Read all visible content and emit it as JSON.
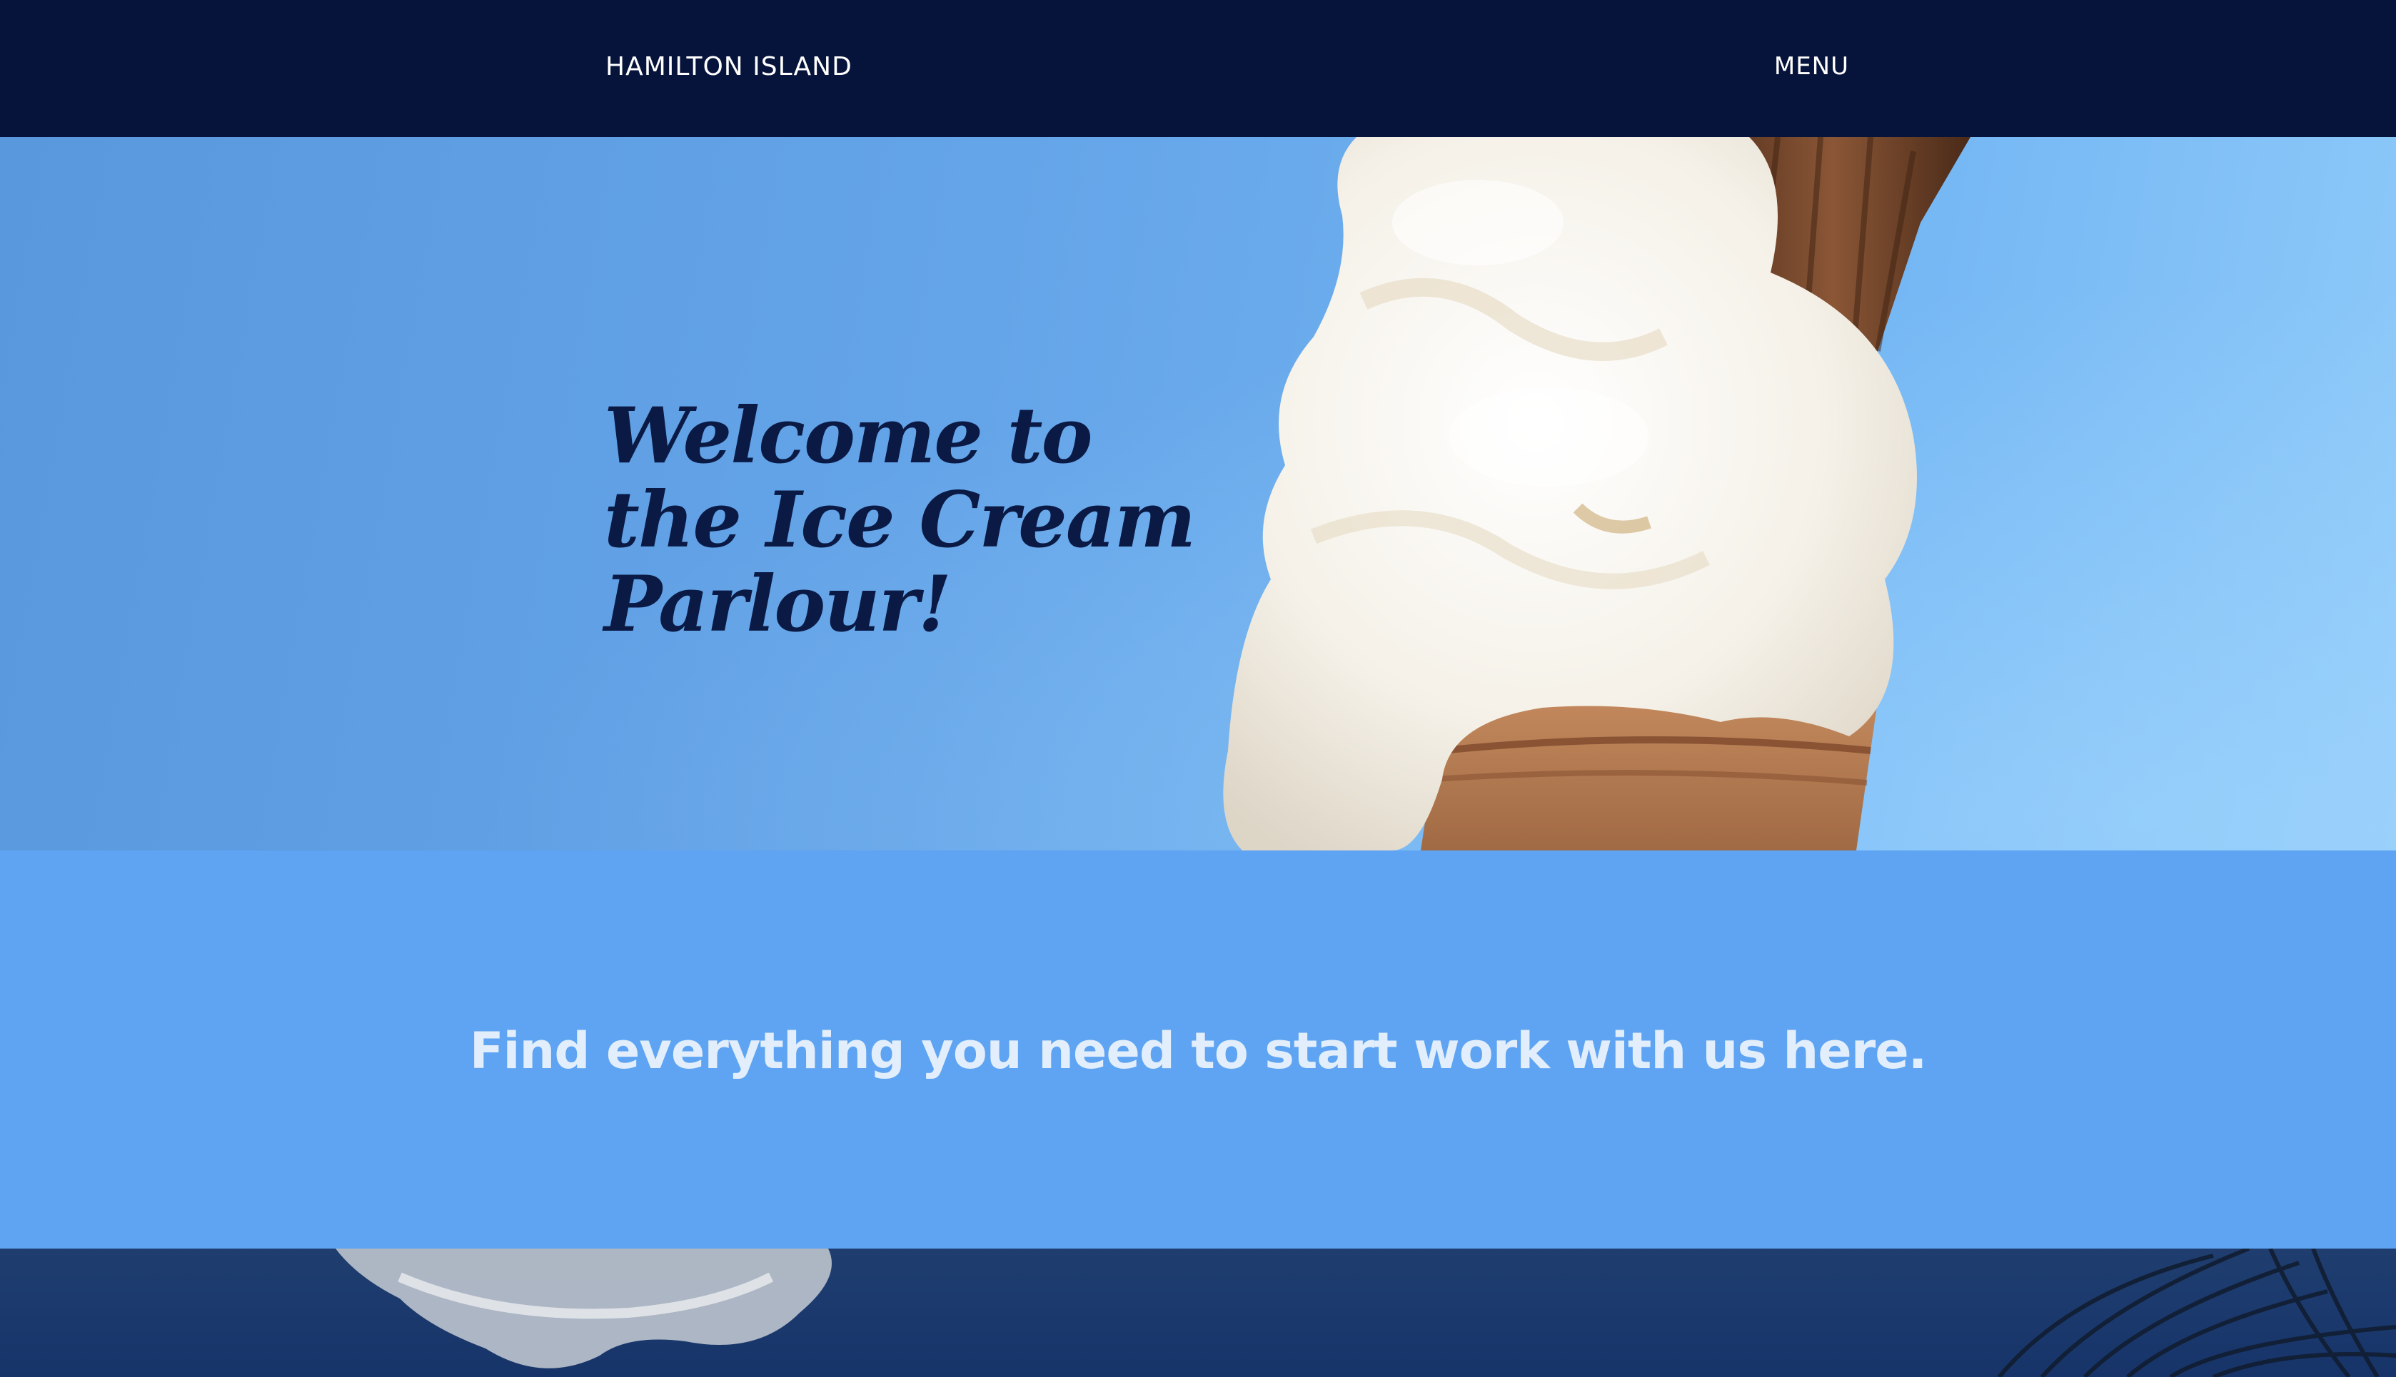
{
  "header": {
    "brand": "HAMILTON ISLAND",
    "menu_label": "MENU"
  },
  "hero": {
    "title": "Welcome to the Ice Cream Parlour!",
    "image_alt": "ice-cream-cone-photo"
  },
  "info": {
    "text": "Find everything you need to start work with us here."
  },
  "bottom": {
    "image_alt": "sky-clouds-palm-photo"
  },
  "colors": {
    "header_bg": "#06133a",
    "hero_sky": "#64a4e8",
    "info_bg": "#5ea4f2",
    "title_color": "#0a1a45",
    "info_text": "#e2eefb"
  }
}
